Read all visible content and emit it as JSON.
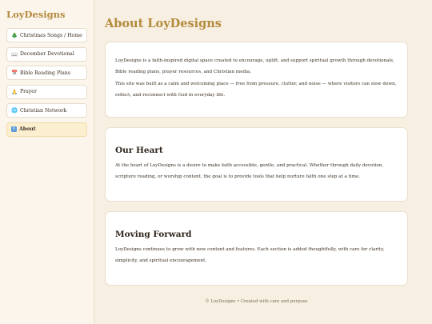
{
  "brand": "LoyDesigns",
  "nav": [
    {
      "icon": "🎄",
      "label": "Christmas Songs / Home",
      "active": false
    },
    {
      "icon": "📖",
      "label": "December Devotional",
      "active": false
    },
    {
      "icon": "📅",
      "label": "Bible Reading Plans",
      "active": false
    },
    {
      "icon": "🙏",
      "label": "Prayer",
      "active": false
    },
    {
      "icon": "🌐",
      "label": "Christian Network",
      "active": false
    },
    {
      "icon": "ℹ",
      "label": "About",
      "active": true
    }
  ],
  "page_title": "About LoyDesigns",
  "intro": {
    "p1": "LoyDesigns is a faith-inspired digital space created to encourage, uplift, and support spiritual growth through devotionals, Bible reading plans, prayer resources, and Christian media.",
    "p2": "This site was built as a calm and welcoming place — free from pressure, clutter, and noise — where visitors can slow down, reflect, and reconnect with God in everyday life."
  },
  "heart": {
    "heading": "Our Heart",
    "text": "At the heart of LoyDesigns is a desire to make faith accessible, gentle, and practical. Whether through daily devotion, scripture reading, or worship content, the goal is to provide tools that help nurture faith one step at a time."
  },
  "forward": {
    "heading": "Moving Forward",
    "text": "LoyDesigns continues to grow with new content and features. Each section is added thoughtfully, with care for clarity, simplicity, and spiritual encouragement."
  },
  "footer": "© LoyDesigns • Created with care and purpose"
}
